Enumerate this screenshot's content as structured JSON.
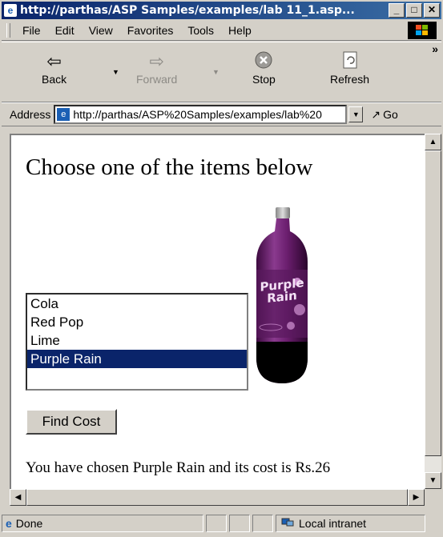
{
  "window": {
    "title": "http://parthas/ASP Samples/examples/lab 11_1.asp..."
  },
  "menu": [
    "File",
    "Edit",
    "View",
    "Favorites",
    "Tools",
    "Help"
  ],
  "toolbar": {
    "back": "Back",
    "forward": "Forward",
    "stop": "Stop",
    "refresh": "Refresh"
  },
  "address": {
    "label": "Address",
    "url": "http://parthas/ASP%20Samples/examples/lab%20",
    "go": "Go"
  },
  "page": {
    "heading": "Choose one of the items below",
    "items": [
      "Cola",
      "Red Pop",
      "Lime",
      "Purple Rain"
    ],
    "selected_index": 3,
    "bottle_label": "Purple Rain",
    "button": "Find Cost",
    "result": "You have chosen Purple Rain and its cost is Rs.26"
  },
  "status": {
    "text": "Done",
    "zone": "Local intranet"
  },
  "colors": {
    "selection": "#0a246a",
    "titlebar": "#0a246a",
    "bottle": "#6b1e6e"
  }
}
